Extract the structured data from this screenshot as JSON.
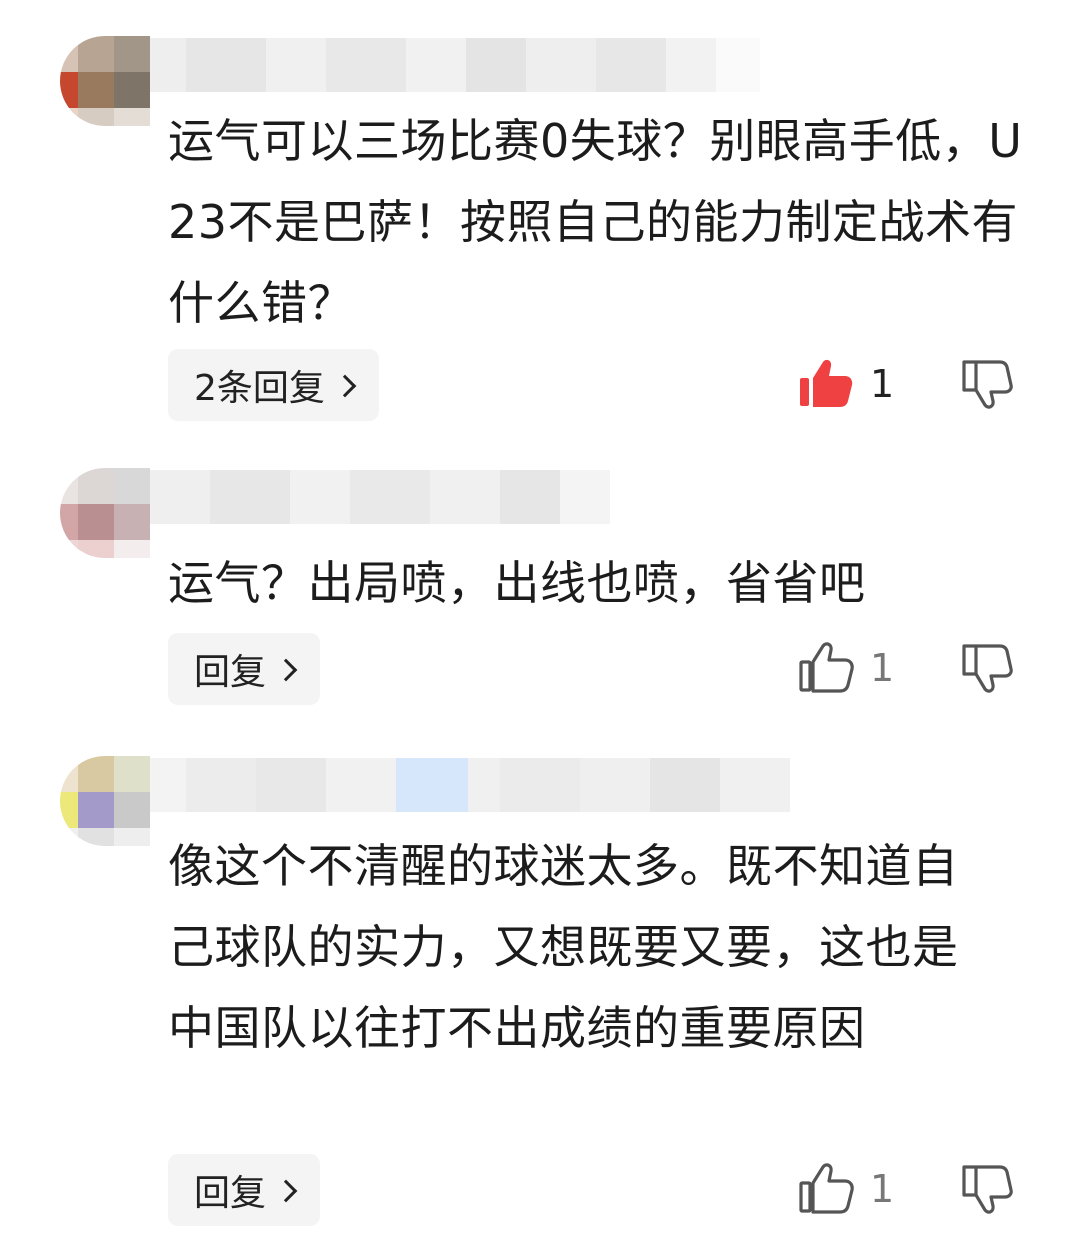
{
  "comments": [
    {
      "text": "运气可以三场比赛0失球？别眼高手低，U23不是巴萨！按照自己的能力制定战术有什么错？",
      "reply_label": "2条回复",
      "like_count": "1",
      "liked": true
    },
    {
      "text": "运气？出局喷，出线也喷，省省吧",
      "reply_label": "回复",
      "like_count": "1",
      "liked": false
    },
    {
      "text": "像这个不清醒的球迷太多。既不知道自己球队的实力，又想既要又要，这也是中国队以往打不出成绩的重要原因",
      "reply_label": "回复",
      "like_count": "1",
      "liked": false
    }
  ],
  "icons": {
    "like": "thumbs-up-icon",
    "dislike": "thumbs-down-icon",
    "chevron": "chevron-right-icon"
  },
  "colors": {
    "like_active": "#f04142",
    "icon_muted": "#555555",
    "reply_bg": "#f4f4f4"
  }
}
